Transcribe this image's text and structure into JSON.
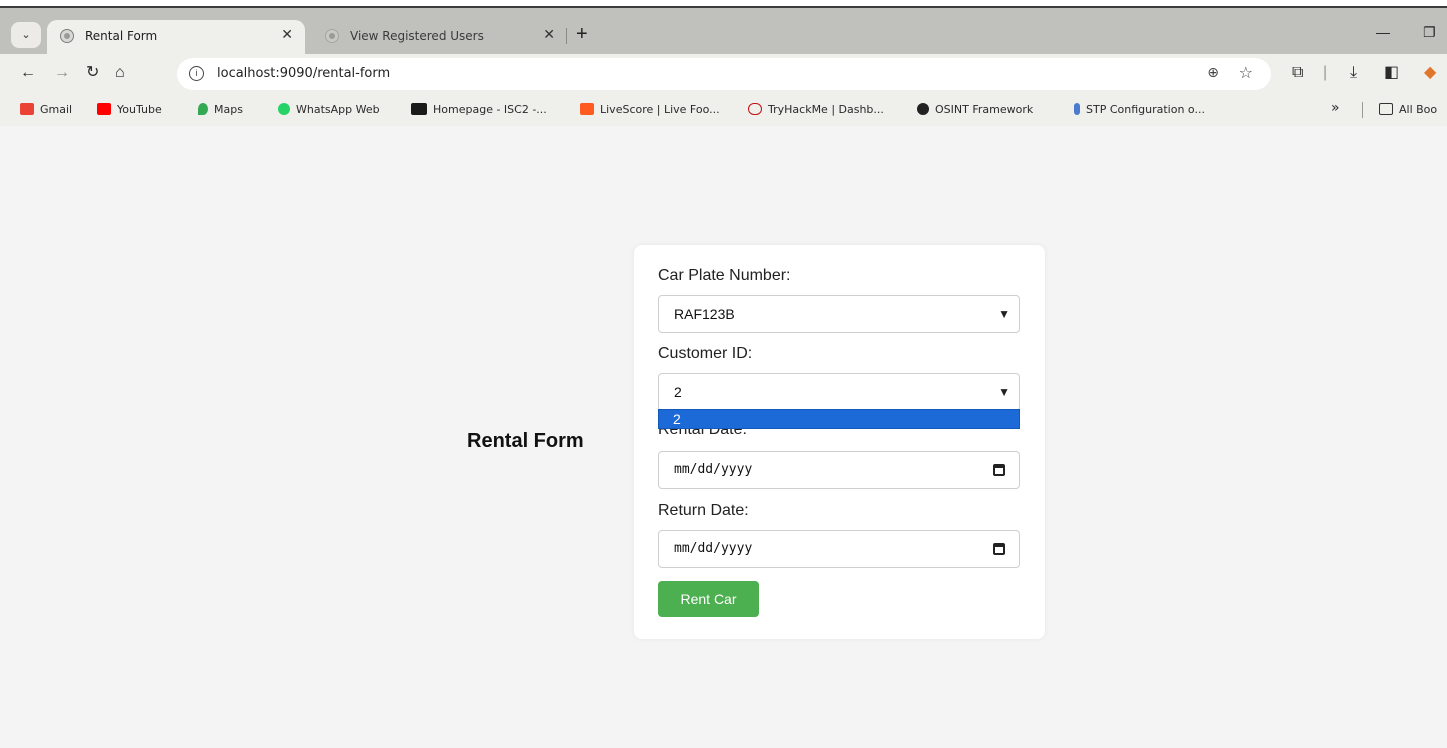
{
  "browser": {
    "tabs": [
      {
        "label": "Rental Form",
        "active": true
      },
      {
        "label": "View Registered Users",
        "active": false
      }
    ],
    "url": "localhost:9090/rental-form",
    "bookmarks": [
      {
        "label": "Gmail",
        "color": "#ea4335"
      },
      {
        "label": "YouTube",
        "color": "#ff0000"
      },
      {
        "label": "Maps",
        "color": "#34a853"
      },
      {
        "label": "WhatsApp Web",
        "color": "#25d366"
      },
      {
        "label": "Homepage - ISC2 -...",
        "color": "#1a1a1a"
      },
      {
        "label": "LiveScore | Live Foo...",
        "color": "#ff5a1f"
      },
      {
        "label": "TryHackMe | Dashb...",
        "color": "#c11111"
      },
      {
        "label": "OSINT Framework",
        "color": "#222222"
      },
      {
        "label": "STP Configuration o...",
        "color": "#4a7bd0"
      }
    ],
    "bookmarks_more": "»",
    "all_bookmarks": "All Boo"
  },
  "page": {
    "title": "Rental Form",
    "form": {
      "car_plate_label": "Car Plate Number:",
      "car_plate_value": "RAF123B",
      "customer_label": "Customer ID:",
      "customer_value": "2",
      "customer_option_highlighted": "2",
      "rental_date_label": "Rental Date:",
      "rental_date_placeholder": "mm/dd/yyyy",
      "return_date_label": "Return Date:",
      "return_date_placeholder": "mm/dd/yyyy",
      "submit_label": "Rent Car"
    }
  },
  "colors": {
    "primary_button": "#4caf50",
    "dropdown_highlight": "#1b6ad7"
  }
}
